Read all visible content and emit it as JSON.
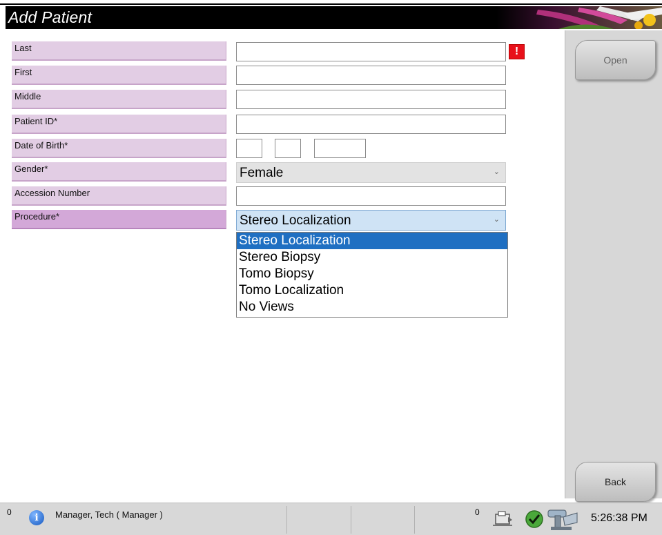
{
  "window": {
    "title": "Add Patient"
  },
  "form": {
    "fields": [
      {
        "label": "Last",
        "value": ""
      },
      {
        "label": "First",
        "value": ""
      },
      {
        "label": "Middle",
        "value": ""
      },
      {
        "label": "Patient ID*",
        "value": ""
      },
      {
        "label": "Date of Birth*",
        "value": ""
      },
      {
        "label": "Gender*",
        "value": "Female"
      },
      {
        "label": "Accession Number",
        "value": ""
      },
      {
        "label": "Procedure*",
        "value": "Stereo Localization"
      }
    ],
    "alert_symbol": "!"
  },
  "procedure_options": [
    "Stereo Localization",
    "Stereo Biopsy",
    "Tomo Biopsy",
    "Tomo Localization",
    "No Views"
  ],
  "side": {
    "open_label": "Open",
    "back_label": "Back"
  },
  "status": {
    "left_count": "0",
    "user": "Manager, Tech ( Manager )",
    "right_count": "0",
    "time": "5:26:38 PM"
  },
  "icons": {
    "info": "info-icon",
    "alert": "alert-icon",
    "chevron": "chevron-down-icon",
    "system": "system-status-icon",
    "check": "check-icon",
    "gantry": "gantry-icon"
  },
  "colors": {
    "label_bg": "#e2cde4",
    "procedure_label_bg": "#d3a8d8",
    "selection_blue": "#1f6fc2",
    "alert_red": "#e8101a"
  }
}
